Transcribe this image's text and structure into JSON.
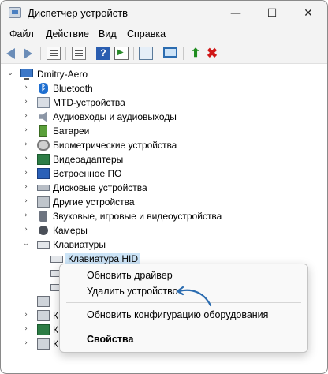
{
  "window": {
    "title": "Диспетчер устройств",
    "min_glyph": "—",
    "max_glyph": "☐",
    "close_glyph": "✕"
  },
  "menu": [
    "Файл",
    "Действие",
    "Вид",
    "Справка"
  ],
  "toolbar": {
    "icons": [
      "back-arrow-icon",
      "forward-arrow-icon",
      "properties-icon",
      "list-icon",
      "help-icon",
      "run-icon",
      "scan-hardware-icon",
      "monitor-icon",
      "update-driver-icon",
      "uninstall-icon"
    ],
    "help_glyph": "?",
    "update_glyph": "⬆",
    "uninstall_glyph": "✖"
  },
  "tree": {
    "root": "Dmitry-Aero",
    "categories": [
      "Bluetooth",
      "MTD-устройства",
      "Аудиовходы и аудиовыходы",
      "Батареи",
      "Биометрические устройства",
      "Видеоадаптеры",
      "Встроенное ПО",
      "Дисковые устройства",
      "Другие устройства",
      "Звуковые, игровые и видеоустройства",
      "Камеры",
      "Клавиатуры"
    ],
    "selected_child": "Клавиатура HID",
    "hidden_rows_prefix": [
      "К",
      "К",
      "К"
    ]
  },
  "context_menu": {
    "items": [
      "Обновить драйвер",
      "Удалить устройство",
      "Обновить конфигурацию оборудования",
      "Свойства"
    ]
  },
  "colors": {
    "chrome": "#f3f3f3",
    "selection": "#cce4f7",
    "pointer": "#2b6cb0"
  }
}
